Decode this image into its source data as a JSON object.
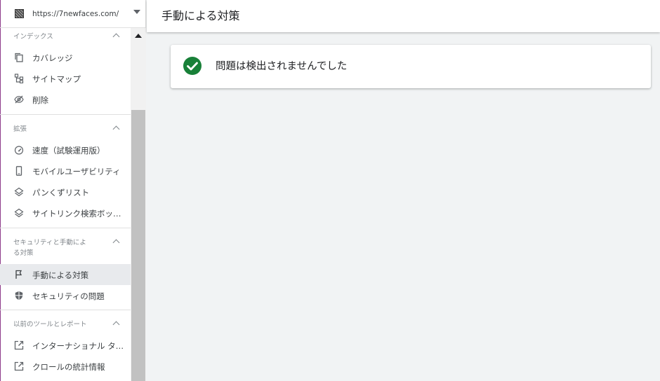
{
  "property": {
    "url": "https://7newfaces.com/"
  },
  "sidebar": {
    "sections": [
      {
        "title": "インデックス",
        "items": [
          "カバレッジ",
          "サイトマップ",
          "削除"
        ]
      },
      {
        "title": "拡張",
        "items": [
          "速度（試験運用版）",
          "モバイルユーザビリティ",
          "パンくずリスト",
          "サイトリンク検索ボッ…"
        ]
      },
      {
        "title_line1": "セキュリティと手動によ",
        "title_line2": "る対策",
        "items": [
          "手動による対策",
          "セキュリティの問題"
        ]
      },
      {
        "title": "以前のツールとレポート",
        "items": [
          "インターナショナル タ…",
          "クロールの統計情報"
        ]
      }
    ],
    "active_item": "手動による対策"
  },
  "header": {
    "title": "手動による対策"
  },
  "main": {
    "status_message": "問題は検出されませんでした"
  },
  "colors": {
    "success": "#188038",
    "accent_border": "#8e3b8a",
    "active_bg": "#e8eaed"
  },
  "icons": {
    "coverage": "copy-icon",
    "sitemaps": "sitemap-icon",
    "removals": "eye-off-icon",
    "speed": "speedometer-icon",
    "mobile": "phone-icon",
    "breadcrumbs": "layers-icon",
    "sitelinks": "layers-icon",
    "manual_actions": "flag-icon",
    "security": "shield-icon",
    "legacy": "external-link-icon"
  }
}
